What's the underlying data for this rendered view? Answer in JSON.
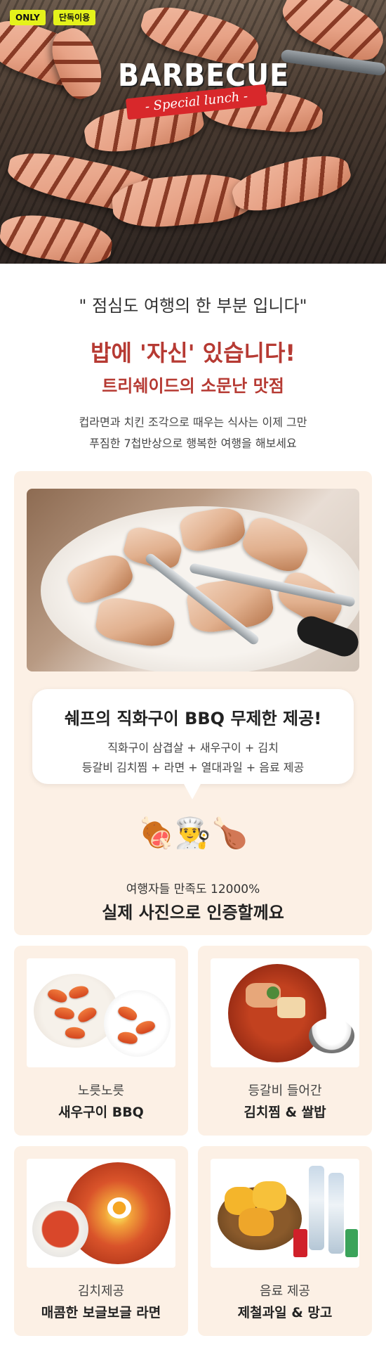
{
  "hero": {
    "badge_only": "ONLY",
    "badge_solo": "단독이용",
    "logo_title": "BARBECUE",
    "logo_subtitle": "- Special lunch -"
  },
  "intro": {
    "quote": "\" 점심도 여행의 한 부분 입니다\"",
    "headline": "밥에 '자신' 있습니다!",
    "subheadline": "트리쉐이드의 소문난 맛점",
    "desc_line1": "컵라면과 치킨 조각으로 때우는 식사는 이제 그만",
    "desc_line2": "푸짐한 7첩반상으로 행복한 여행을 해보세요"
  },
  "chef": {
    "bubble_title": "쉐프의 직화구이 BBQ 무제한 제공!",
    "bubble_line1": "직화구이 삼겹살 + 새우구이 + 김치",
    "bubble_line2": "등갈비 김치찜 + 라면 + 열대과일 + 음료 제공",
    "emojis": "🍖👨‍🍳🍗",
    "satisfaction": "여행자들 만족도 12000%",
    "proof": "실제 사진으로 인증할께요"
  },
  "menu": [
    {
      "sub": "노릇노릇",
      "main": "새우구이 BBQ"
    },
    {
      "sub": "등갈비 들어간",
      "main": "김치찜 & 쌀밥"
    },
    {
      "sub": "김치제공",
      "main": "매콤한 보글보글 라면"
    },
    {
      "sub": "음료 제공",
      "main": "제철과일 & 망고"
    }
  ],
  "colors": {
    "accent_red": "#b63a33",
    "badge_yellow": "#e5f21b",
    "card_bg": "#fcf0e5"
  }
}
